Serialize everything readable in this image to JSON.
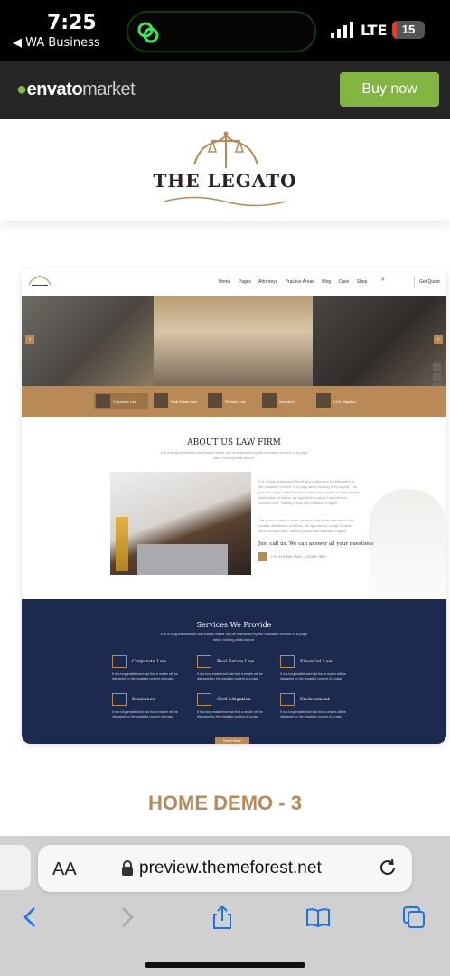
{
  "status_bar": {
    "time": "7:25",
    "back_app": "◀ WA Business",
    "network": "LTE",
    "battery": "15",
    "battery_level": 0.15
  },
  "envato": {
    "logo_bold": "envato",
    "logo_light": "market",
    "buy_label": "Buy now"
  },
  "brand": {
    "title": "THE LEGATO"
  },
  "preview": {
    "nav": [
      "Home",
      "Pages",
      "Attorneys",
      "Practice Areas",
      "Blog",
      "Case",
      "Shop"
    ],
    "nav_cta": "Get Quote",
    "categories": [
      "Corporate Law",
      "Real Estate Law",
      "Finance Law",
      "Insurance",
      "Civil Litigation"
    ],
    "about": {
      "title": "ABOUT US LAW FIRM",
      "subtitle": "It is a long established fact that a reader will be distracted by the readable content of a page when looking at its layout.",
      "para1": "It is a long established fact that a reader will be distracted by the readable content of a page when looking at its layout. The point of using Lorem Ipsum is that it has a more-or-less normal distribution of letters, as opposed to using Content here, content here, making it look like readable English.",
      "para2": "The point of using Lorem Ipsum is that it has a more-or-less normal distribution of letters, as opposed to using Content here, content here, making it look like readable English.",
      "call": "Just call us. We can answer all your questions",
      "phone": "(+1) 123 456 7890 / 123 456 7890"
    },
    "services": {
      "title": "Services We Provide",
      "subtitle": "It is a long established fact that a reader will be distracted by the readable content of a page when looking at its layout.",
      "items": [
        {
          "title": "Corporate Law",
          "desc": "It is a long established fact that a reader will be distracted by the readable content of a page."
        },
        {
          "title": "Real Estate Law",
          "desc": "It is a long established fact that a reader will be distracted by the readable content of a page."
        },
        {
          "title": "Financial Law",
          "desc": "It is a long established fact that a reader will be distracted by the readable content of a page."
        },
        {
          "title": "Insurance",
          "desc": "It is a long established fact that a reader will be distracted by the readable content of a page."
        },
        {
          "title": "Civil Litigation",
          "desc": "It is a long established fact that a reader will be distracted by the readable content of a page."
        },
        {
          "title": "Environment",
          "desc": "It is a long established fact that a reader will be distracted by the readable content of a page."
        }
      ],
      "more_label": "Read More"
    }
  },
  "demo_title": "HOME DEMO - 3",
  "safari": {
    "aa_label": "AA",
    "domain": "preview.themeforest.net"
  },
  "colors": {
    "accent": "#b98a55",
    "navy": "#1d2a4f",
    "envato_green": "#82b541"
  }
}
